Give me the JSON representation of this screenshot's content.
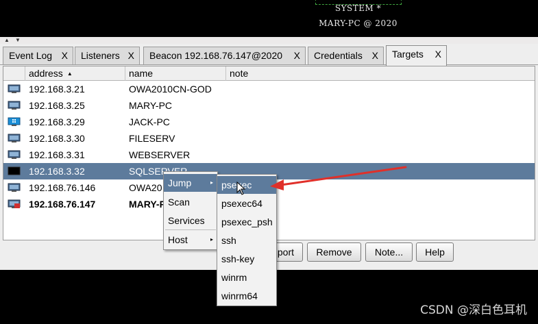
{
  "graph": {
    "node_line1": "SYSTEM *",
    "node_line2": "MARY-PC @ 2020"
  },
  "tabs": [
    {
      "label": "Event Log",
      "close": "X"
    },
    {
      "label": "Listeners",
      "close": "X"
    },
    {
      "label": "Beacon 192.168.76.147@2020",
      "close": "X"
    },
    {
      "label": "Credentials",
      "close": "X"
    },
    {
      "label": "Targets",
      "close": "X",
      "active": true
    }
  ],
  "table": {
    "columns": [
      "address",
      "name",
      "note"
    ],
    "sort_indicator": "▲",
    "rows": [
      {
        "address": "192.168.3.21",
        "name": "OWA2010CN-GOD",
        "note": "",
        "os_icon": "windows-server-icon"
      },
      {
        "address": "192.168.3.25",
        "name": "MARY-PC",
        "note": "",
        "os_icon": "windows-server-icon"
      },
      {
        "address": "192.168.3.29",
        "name": "JACK-PC",
        "note": "",
        "os_icon": "windows-10-icon"
      },
      {
        "address": "192.168.3.30",
        "name": "FILESERV",
        "note": "",
        "os_icon": "windows-server-icon"
      },
      {
        "address": "192.168.3.31",
        "name": "WEBSERVER",
        "note": "",
        "os_icon": "windows-server-icon"
      },
      {
        "address": "192.168.3.32",
        "name": "SQLSERVER",
        "note": "",
        "os_icon": "unknown-os-icon",
        "selected": true
      },
      {
        "address": "192.168.76.146",
        "name": "OWA20",
        "note": "",
        "os_icon": "windows-server-icon"
      },
      {
        "address": "192.168.76.147",
        "name": "MARY-P",
        "note": "",
        "os_icon": "windows-server-compromised-icon",
        "bold": true
      }
    ]
  },
  "buttons": {
    "import": "port",
    "remove": "Remove",
    "note": "Note...",
    "help": "Help"
  },
  "context_menu": {
    "items": [
      "Jump",
      "Scan",
      "Services",
      "Host"
    ],
    "submenu_arrow": "▸"
  },
  "jump_menu": {
    "items": [
      "psexec",
      "psexec64",
      "psexec_psh",
      "ssh",
      "ssh-key",
      "winrm",
      "winrm64"
    ]
  },
  "watermark": "CSDN @深白色耳机",
  "colors": {
    "selection": "#5d7b9c",
    "annotation_arrow": "#e0302a"
  }
}
